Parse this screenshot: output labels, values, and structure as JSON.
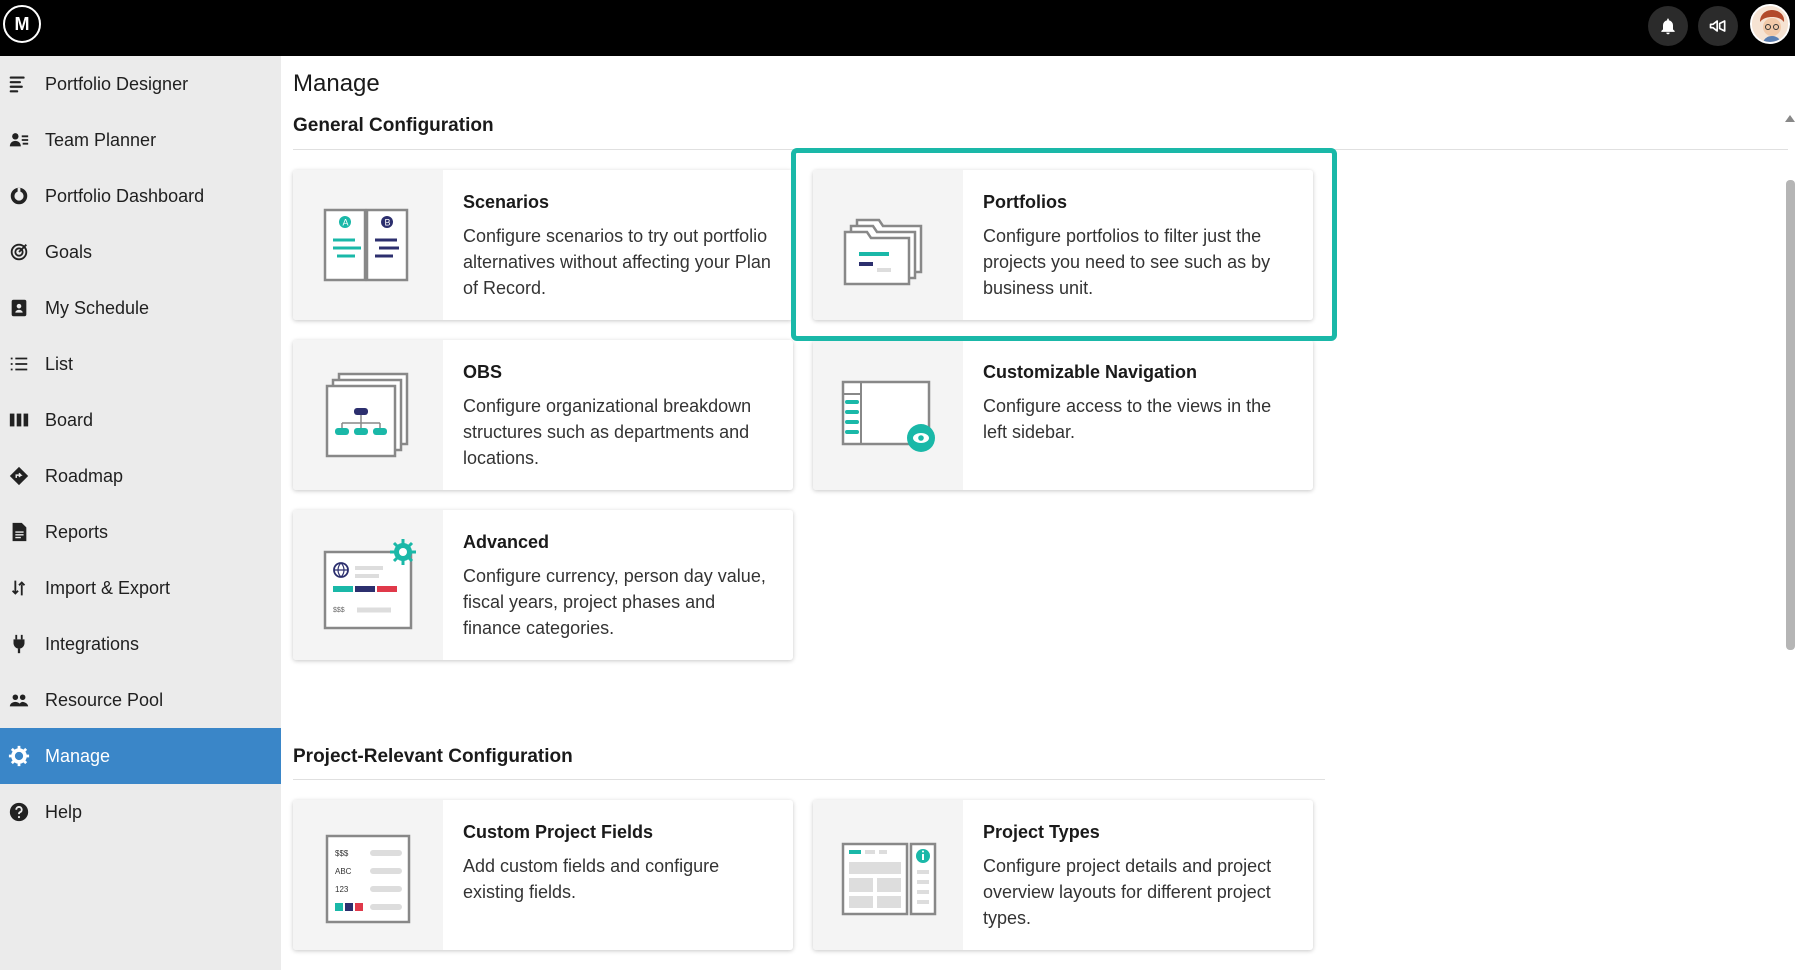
{
  "topbar": {
    "logo_text": "M",
    "notification_icon": "bell-icon",
    "announce_icon": "megaphone-icon",
    "avatar_icon": "avatar"
  },
  "sidebar": {
    "active_color": "#3a86c8",
    "items": [
      {
        "label": "Portfolio Designer",
        "icon": "portfolio-designer-icon"
      },
      {
        "label": "Team Planner",
        "icon": "team-planner-icon"
      },
      {
        "label": "Portfolio Dashboard",
        "icon": "dashboard-icon"
      },
      {
        "label": "Goals",
        "icon": "target-icon"
      },
      {
        "label": "My Schedule",
        "icon": "badge-icon"
      },
      {
        "label": "List",
        "icon": "list-icon"
      },
      {
        "label": "Board",
        "icon": "board-icon"
      },
      {
        "label": "Roadmap",
        "icon": "roadmap-icon"
      },
      {
        "label": "Reports",
        "icon": "document-icon"
      },
      {
        "label": "Import & Export",
        "icon": "import-export-icon"
      },
      {
        "label": "Integrations",
        "icon": "plug-icon"
      },
      {
        "label": "Resource Pool",
        "icon": "people-icon"
      },
      {
        "label": "Manage",
        "icon": "gear-icon",
        "active": true
      },
      {
        "label": "Help",
        "icon": "help-icon"
      }
    ]
  },
  "main": {
    "title": "Manage",
    "general": {
      "title": "General Configuration",
      "cards": [
        {
          "title": "Scenarios",
          "desc": "Configure scenarios to try out portfolio alternatives without affecting your Plan of Record.",
          "icon": "scenarios-icon"
        },
        {
          "title": "Portfolios",
          "desc": "Configure portfolios to filter just the projects you need to see such as by business unit.",
          "icon": "portfolios-folder-icon",
          "highlighted": true
        },
        {
          "title": "OBS",
          "desc": "Configure organizational breakdown structures such as departments and locations.",
          "icon": "obs-hierarchy-icon"
        },
        {
          "title": "Customizable Navigation",
          "desc": "Configure access to the views in the left sidebar.",
          "icon": "navigation-eye-icon"
        },
        {
          "title": "Advanced",
          "desc": "Configure currency, person day value, fiscal years, project phases and finance categories.",
          "icon": "advanced-settings-icon"
        }
      ]
    },
    "project": {
      "title": "Project-Relevant Configuration",
      "cards": [
        {
          "title": "Custom Project Fields",
          "desc": "Add custom fields and configure existing fields.",
          "icon": "custom-fields-icon",
          "field_labels": [
            "$$$",
            "ABC",
            "123"
          ]
        },
        {
          "title": "Project Types",
          "desc": "Configure project details and project overview layouts for different project types.",
          "icon": "project-types-icon"
        }
      ]
    },
    "advanced_icon_label": "$$$",
    "accent_color": "#1ab8a8"
  }
}
